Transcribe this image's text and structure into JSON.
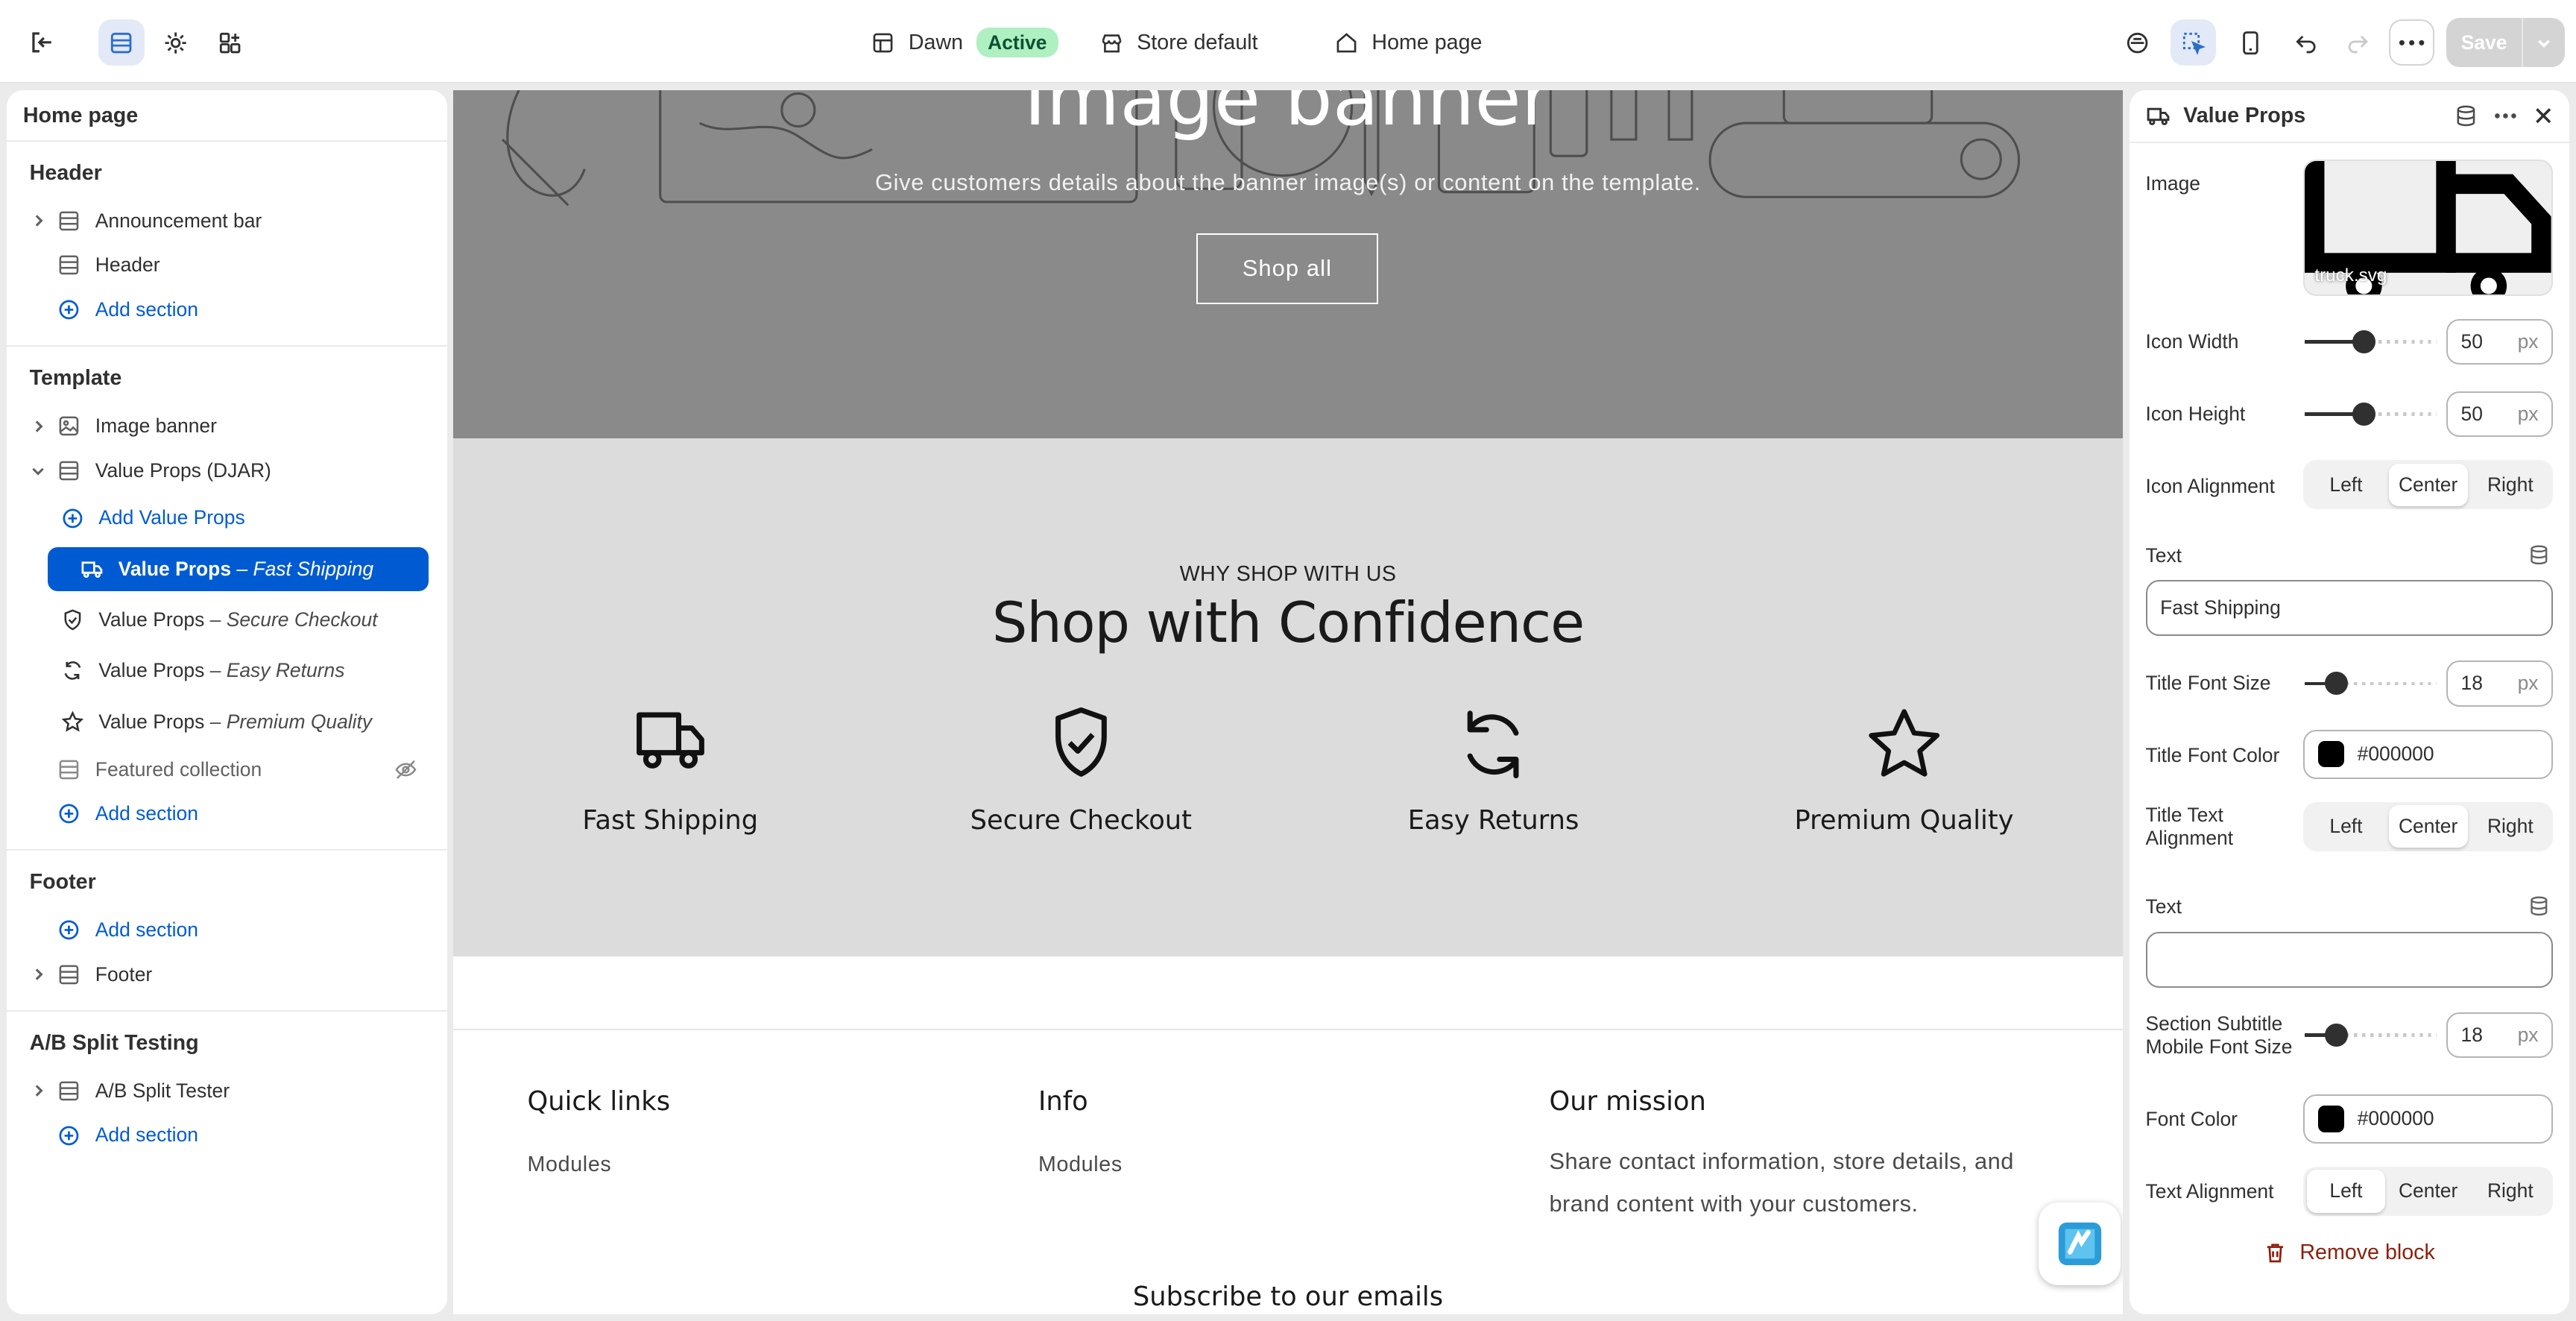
{
  "topbar": {
    "theme_name": "Dawn",
    "theme_status": "Active",
    "store": "Store default",
    "page": "Home page",
    "save_label": "Save",
    "icons": [
      "exit-icon",
      "sections-icon",
      "settings-icon",
      "apps-icon",
      "theme-icon",
      "inspector-icon",
      "mobile-icon",
      "undo-icon",
      "redo-icon",
      "more-icon",
      "store-icon",
      "home-icon"
    ]
  },
  "left": {
    "title": "Home page",
    "header_group": {
      "title": "Header",
      "items": [
        "Announcement bar",
        "Header"
      ],
      "add": "Add section"
    },
    "template_group": {
      "title": "Template",
      "image_banner": "Image banner",
      "value_props": "Value Props (DJAR)",
      "add_block": "Add Value Props",
      "blocks": [
        {
          "name": "Value Props",
          "sub": "– Fast Shipping",
          "icon": "truck-icon"
        },
        {
          "name": "Value Props",
          "sub": "– Secure Checkout",
          "icon": "shield-icon"
        },
        {
          "name": "Value Props",
          "sub": "– Easy Returns",
          "icon": "refresh-icon"
        },
        {
          "name": "Value Props",
          "sub": "– Premium Quality",
          "icon": "star-icon"
        }
      ],
      "featured": "Featured collection",
      "add": "Add section"
    },
    "footer_group": {
      "title": "Footer",
      "add": "Add section",
      "items": [
        "Footer"
      ]
    },
    "ab_group": {
      "title": "A/B Split Testing",
      "items": [
        "A/B Split Tester"
      ],
      "add": "Add section"
    }
  },
  "preview": {
    "banner": {
      "title": "Image banner",
      "subtitle": "Give customers details about the banner image(s) or content on the template.",
      "button": "Shop all"
    },
    "value_props": {
      "eyebrow": "WHY SHOP WITH US",
      "heading": "Shop with Confidence",
      "items": [
        {
          "label": "Fast Shipping",
          "icon": "truck-icon"
        },
        {
          "label": "Secure Checkout",
          "icon": "shield-check-icon"
        },
        {
          "label": "Easy Returns",
          "icon": "refresh-icon"
        },
        {
          "label": "Premium Quality",
          "icon": "star-icon"
        }
      ]
    },
    "footer": {
      "quick_links": {
        "title": "Quick links",
        "link": "Modules"
      },
      "info": {
        "title": "Info",
        "link": "Modules"
      },
      "mission": {
        "title": "Our mission",
        "text": "Share contact information, store details, and brand content with your customers."
      },
      "subscribe": "Subscribe to our emails"
    }
  },
  "right": {
    "title": "Value Props",
    "image_label": "Image",
    "image_file": "truck.svg",
    "icon_width": {
      "label": "Icon Width",
      "value": "50",
      "unit": "px",
      "level": 0.45
    },
    "icon_height": {
      "label": "Icon Height",
      "value": "50",
      "unit": "px",
      "level": 0.45
    },
    "icon_alignment": {
      "label": "Icon Alignment",
      "options": [
        "Left",
        "Center",
        "Right"
      ],
      "selected": "Center"
    },
    "text1": {
      "label": "Text",
      "value": "Fast Shipping"
    },
    "title_font_size": {
      "label": "Title Font Size",
      "value": "18",
      "unit": "px",
      "level": 0.24
    },
    "title_font_color": {
      "label": "Title Font Color",
      "value": "#000000"
    },
    "title_text_alignment": {
      "label": "Title Text Alignment",
      "options": [
        "Left",
        "Center",
        "Right"
      ],
      "selected": "Center"
    },
    "text2": {
      "label": "Text",
      "value": ""
    },
    "subtitle_mobile_size": {
      "label": "Section Subtitle Mobile Font Size",
      "value": "18",
      "unit": "px",
      "level": 0.24
    },
    "font_color": {
      "label": "Font Color",
      "value": "#000000"
    },
    "text_alignment": {
      "label": "Text Alignment",
      "options": [
        "Left",
        "Center",
        "Right"
      ],
      "selected": "Left"
    },
    "remove": "Remove block"
  }
}
